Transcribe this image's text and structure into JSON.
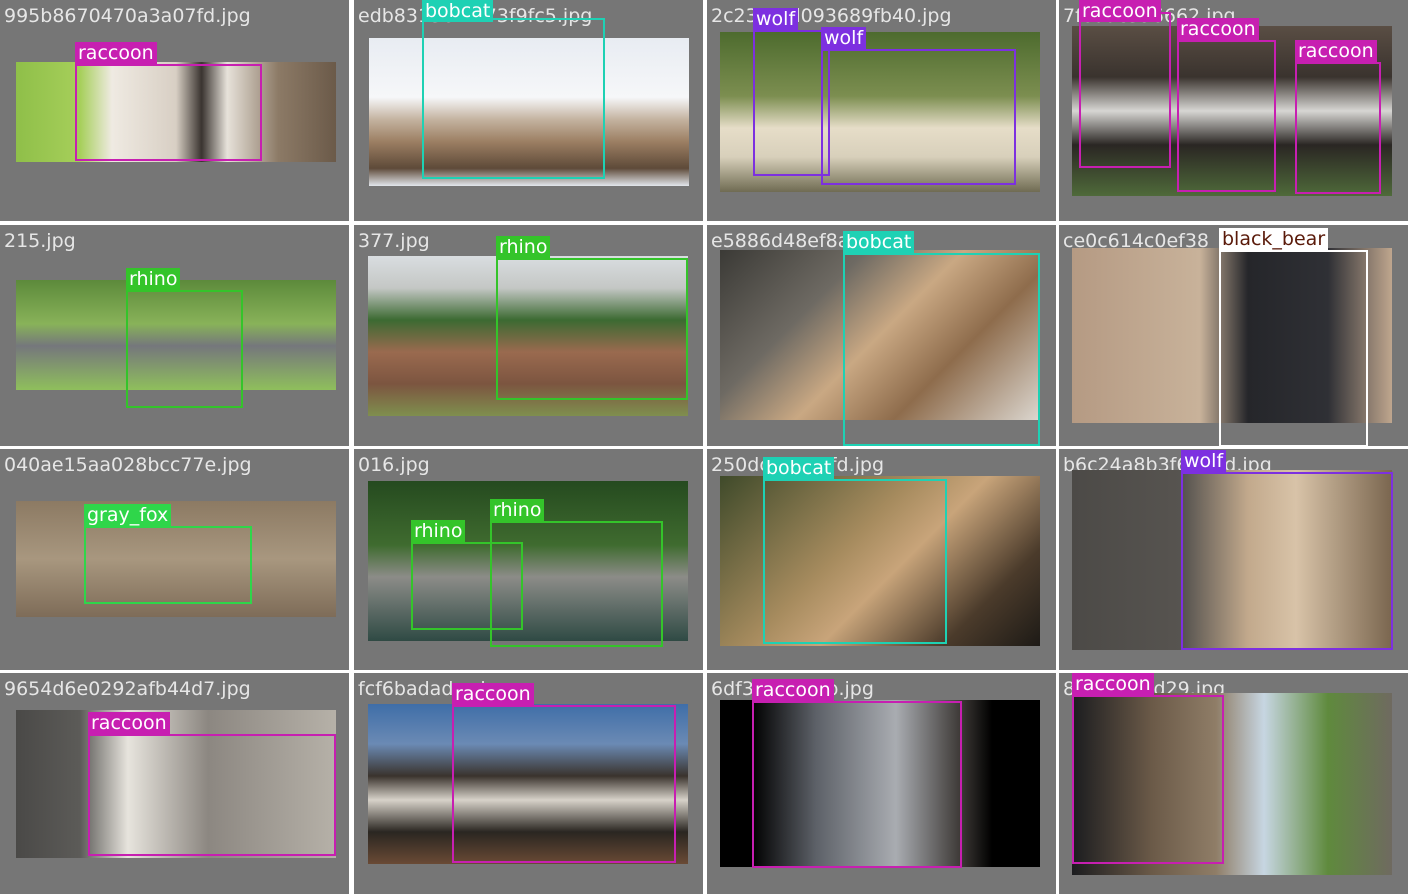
{
  "colors": {
    "raccoon": "#c71fb1",
    "bobcat": "#1ed1b4",
    "wolf": "#7d30e0",
    "rhino": "#34c42a",
    "gray_fox": "#2fd64a",
    "black_bear": "#ffffff",
    "black_bear_text": "#5a1a0a"
  },
  "tiles": [
    {
      "filename": "995b8670470a3a07fd.jpg",
      "detections": [
        {
          "label": "raccoon"
        }
      ]
    },
    {
      "filename": "edb8313e2f473f9fc5.jpg",
      "detections": [
        {
          "label": "bobcat"
        }
      ]
    },
    {
      "filename": "2c23f47d093689fb40.jpg",
      "detections": [
        {
          "label": "wolf"
        },
        {
          "label": "wolf"
        }
      ]
    },
    {
      "filename": "7f0aac356662.jpg",
      "detections": [
        {
          "label": "raccoon"
        },
        {
          "label": "raccoon"
        },
        {
          "label": "raccoon"
        }
      ]
    },
    {
      "filename": "215.jpg",
      "detections": [
        {
          "label": "rhino"
        }
      ]
    },
    {
      "filename": "377.jpg",
      "detections": [
        {
          "label": "rhino"
        }
      ]
    },
    {
      "filename": "e5886d48ef8a.jpg",
      "detections": [
        {
          "label": "bobcat"
        }
      ]
    },
    {
      "filename": "ce0c614c0ef38",
      "detections": [
        {
          "label": "black_bear"
        }
      ]
    },
    {
      "filename": "040ae15aa028bcc77e.jpg",
      "detections": [
        {
          "label": "gray_fox"
        }
      ]
    },
    {
      "filename": "016.jpg",
      "detections": [
        {
          "label": "rhino"
        },
        {
          "label": "rhino"
        }
      ]
    },
    {
      "filename": "250dc1e417fd.jpg",
      "detections": [
        {
          "label": "bobcat"
        }
      ]
    },
    {
      "filename": "b6c24a8b3f69ebd.jpg",
      "detections": [
        {
          "label": "wolf"
        }
      ]
    },
    {
      "filename": "9654d6e0292afb44d7.jpg",
      "detections": [
        {
          "label": "raccoon"
        }
      ]
    },
    {
      "filename": "fcf6badadcc.jpg",
      "detections": [
        {
          "label": "raccoon"
        }
      ]
    },
    {
      "filename": "6df330480bb.jpg",
      "detections": [
        {
          "label": "raccoon"
        }
      ]
    },
    {
      "filename": "8f7032eed29.jpg",
      "detections": [
        {
          "label": "raccoon"
        }
      ]
    }
  ]
}
